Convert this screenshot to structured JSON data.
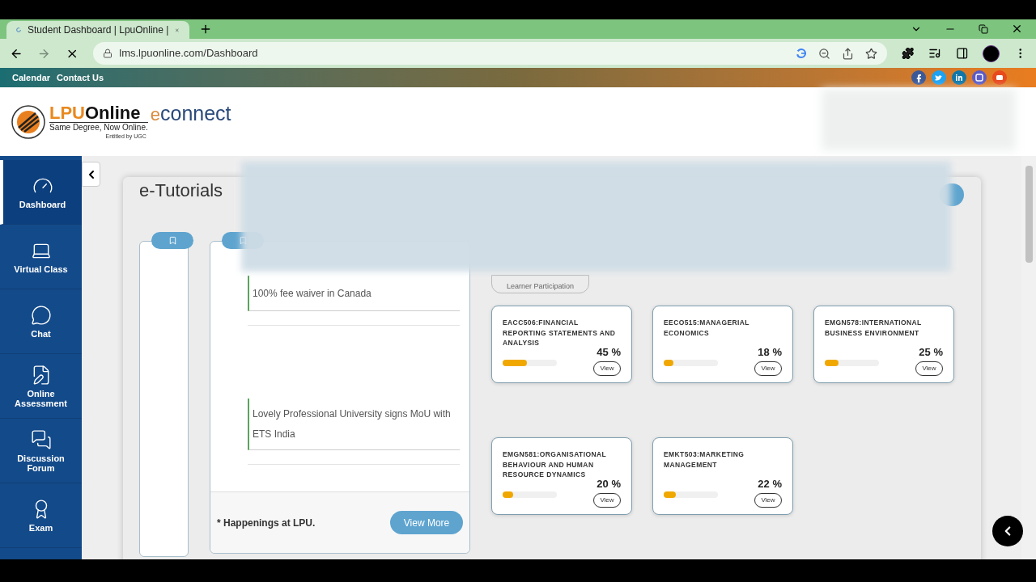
{
  "browser": {
    "tab_title": "Student Dashboard | LpuOnline |",
    "url": "lms.lpuonline.com/Dashboard"
  },
  "top_links": [
    "Calendar",
    "Contact Us"
  ],
  "logo": {
    "brand_a": "LPU",
    "brand_b": "Online",
    "tagline": "Same Degree, Now Online.",
    "note": "Entitled by UGC",
    "partner_a": "e",
    "partner_b": "connect"
  },
  "sidebar": {
    "items": [
      {
        "label": "Dashboard",
        "kind": "gauge",
        "selected": true
      },
      {
        "label": "Virtual Class",
        "kind": "laptop",
        "selected": false
      },
      {
        "label": "Chat",
        "kind": "chat",
        "selected": false
      },
      {
        "label": "Online Assessment",
        "kind": "document",
        "selected": false
      },
      {
        "label": "Discussion Forum",
        "kind": "forum",
        "selected": false
      },
      {
        "label": "Exam",
        "kind": "exam",
        "selected": false
      }
    ]
  },
  "page_title": "e-Tutorials",
  "news": {
    "items": [
      "100% fee waiver in Canada",
      "Lovely Professional University signs MoU with ETS India"
    ],
    "footer": "* Happenings at LPU.",
    "button": "View More"
  },
  "participation_label": "Learner Participation",
  "courses": [
    {
      "title": "EACC506:FINANCIAL REPORTING STATEMENTS AND ANALYSIS",
      "percent": "45 %",
      "level": 0.45,
      "button": "View"
    },
    {
      "title": "EECO515:MANAGERIAL ECONOMICS",
      "percent": "18 %",
      "level": 0.18,
      "button": "View"
    },
    {
      "title": "EMGN578:INTERNATIONAL BUSINESS ENVIRONMENT",
      "percent": "25 %",
      "level": 0.25,
      "button": "View"
    },
    {
      "title": "EMGN581:ORGANISATIONAL BEHAVIOUR AND HUMAN RESOURCE DYNAMICS",
      "percent": "20 %",
      "level": 0.2,
      "button": "View"
    },
    {
      "title": "EMKT503:MARKETING MANAGEMENT",
      "percent": "22 %",
      "level": 0.22,
      "button": "View"
    }
  ]
}
